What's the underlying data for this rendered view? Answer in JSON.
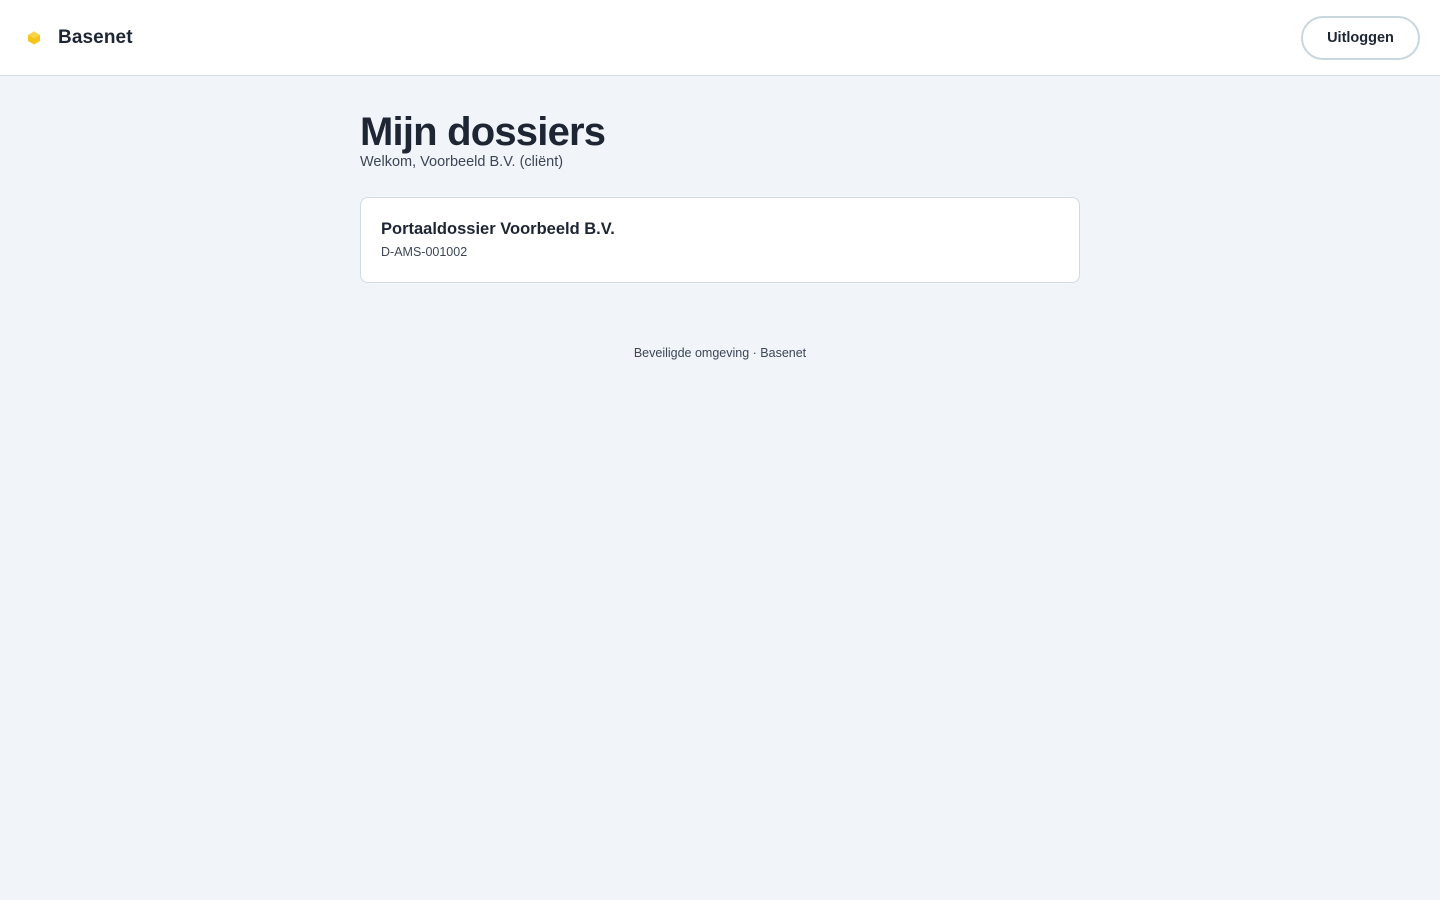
{
  "header": {
    "brand_name": "Basenet",
    "brand_icon": "basenet-logo-icon",
    "brand_color": "#f5c518",
    "logout_label": "Uitloggen"
  },
  "main": {
    "title": "Mijn dossiers",
    "welcome": "Welkom, Voorbeeld B.V. (cliënt)",
    "dossiers": [
      {
        "title": "Portaaldossier Voorbeeld B.V.",
        "code": "D-AMS-001002"
      }
    ]
  },
  "footer": {
    "text": "Beveiligde omgeving · Basenet"
  },
  "colors": {
    "page_background": "#f1f5f9",
    "text_primary": "#1e2533",
    "text_secondary": "#3c4656",
    "border": "#d3dae2"
  }
}
